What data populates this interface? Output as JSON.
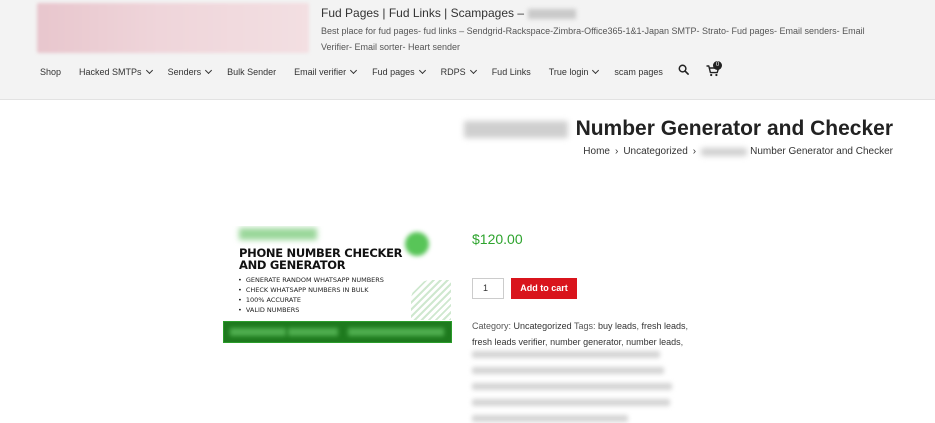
{
  "header": {
    "site_title": "Fud Pages | Fud Links | Scampages –",
    "tagline": "Best place for fud pages- fud links – Sendgrid-Rackspace-Zimbra-Office365-1&1-Japan SMTP- Strato- Fud pages- Email senders- Email Verifier- Email sorter- Heart sender"
  },
  "nav": {
    "items": [
      {
        "label": "Shop",
        "dropdown": false
      },
      {
        "label": "Hacked SMTPs",
        "dropdown": true
      },
      {
        "label": "Senders",
        "dropdown": true
      },
      {
        "label": "Bulk Sender",
        "dropdown": false
      },
      {
        "label": "Email verifier",
        "dropdown": true
      },
      {
        "label": "Fud pages",
        "dropdown": true
      },
      {
        "label": "RDPS",
        "dropdown": true
      },
      {
        "label": "Fud Links",
        "dropdown": false
      },
      {
        "label": "True login",
        "dropdown": true
      },
      {
        "label": "scam pages",
        "dropdown": false
      }
    ],
    "cart_count": "0",
    "icons": [
      "search-icon",
      "cart-icon"
    ]
  },
  "product": {
    "title": "Number Generator and Checker",
    "breadcrumb": {
      "home": "Home",
      "category": "Uncategorized",
      "current": "Number Generator and Checker"
    },
    "image": {
      "heading_line1": "PHONE NUMBER CHECKER",
      "heading_line2": "AND GENERATOR",
      "bullets": [
        "GENERATE RANDOM WHATSAPP NUMBERS",
        "CHECK WHATSAPP NUMBERS IN BULK",
        "100% ACCURATE",
        "VALID NUMBERS"
      ]
    },
    "price": "$120.00",
    "quantity": "1",
    "add_to_cart": "Add to cart",
    "meta": {
      "category_label": "Category:",
      "category": "Uncategorized",
      "tags_label": "Tags:",
      "tags": [
        "buy leads",
        "fresh leads",
        "fresh leads verifier",
        "number generator",
        "number leads"
      ]
    }
  },
  "colors": {
    "accent_red": "#d9141c",
    "price_green": "#2ea42e",
    "header_bg": "#f3f3f3"
  }
}
